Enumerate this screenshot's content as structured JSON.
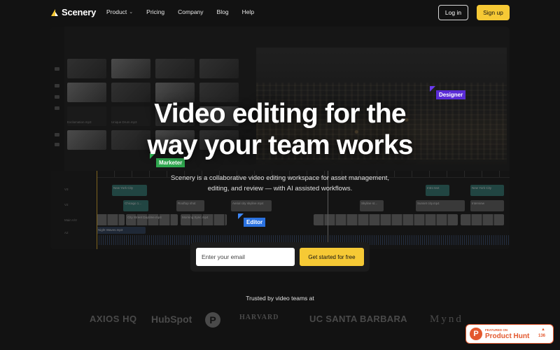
{
  "nav": {
    "brand": "Scenery",
    "links": [
      "Product",
      "Pricing",
      "Company",
      "Blog",
      "Help"
    ],
    "login_label": "Log in",
    "signup_label": "Sign up"
  },
  "colors": {
    "accent": "#f6c935",
    "designer": "#5a2bd6",
    "marketer": "#2fa84f",
    "editor": "#2b72e0",
    "product_hunt": "#e3582e"
  },
  "hero": {
    "title_line1": "Video editing for the",
    "title_line2": "way your team works",
    "subtitle": "Scenery is a collaborative video editing workspace for asset management, editing, and review — with AI assisted workflows."
  },
  "tags": {
    "designer": "Designer",
    "marketer": "Marketer",
    "editor": "Editor"
  },
  "cta": {
    "email_placeholder": "Enter your email",
    "button_label": "Get started for free"
  },
  "trusted": {
    "label": "Trusted by video teams at",
    "logos": [
      "AXIOS HQ",
      "HubSpot",
      "P",
      "HARVARD",
      "UC SANTA BARBARA",
      "Mynd"
    ]
  },
  "product_hunt": {
    "featured": "FEATURED ON",
    "name": "Product Hunt",
    "count": "136"
  },
  "editor_mock": {
    "thumb_captions": [
      "Exclamation.mp3",
      "Unique Drum.mp3",
      "Moving Daydream.mp3"
    ],
    "track_labels": [
      "V3",
      "V2",
      "Main A/V",
      "A2"
    ],
    "clips": {
      "c1": "New York City",
      "c2": "Intro text",
      "c3": "Chicago 1...",
      "c4": "Rooftop shot",
      "c5": "Aerial city skyline.mp4",
      "c6": "Skyline st...",
      "c7": "Sunset city.mp4",
      "c8": "Interview",
      "c9": "Night Waves.mp3",
      "c10": "City Street Daytime.mp4",
      "c11": "Morning Sync.mp4"
    }
  }
}
